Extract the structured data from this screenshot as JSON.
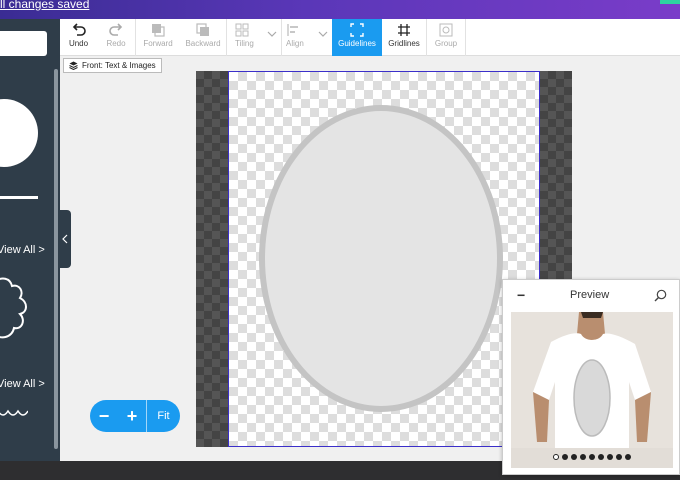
{
  "topbar": {
    "status_text": "ll changes saved"
  },
  "sidebar": {
    "view_all_1": "View All >",
    "view_all_2": "View All >"
  },
  "toolbar": {
    "items": [
      {
        "label": "Undo",
        "icon": "undo-icon",
        "enabled": true
      },
      {
        "label": "Redo",
        "icon": "redo-icon",
        "enabled": false
      },
      {
        "label": "Forward",
        "icon": "bring-forward-icon",
        "enabled": false
      },
      {
        "label": "Backward",
        "icon": "send-backward-icon",
        "enabled": false
      },
      {
        "label": "Tiling",
        "icon": "tiling-icon",
        "enabled": false
      },
      {
        "label": "Align",
        "icon": "align-icon",
        "enabled": false
      },
      {
        "label": "Guidelines",
        "icon": "guidelines-icon",
        "enabled": true,
        "active": true
      },
      {
        "label": "Gridlines",
        "icon": "gridlines-icon",
        "enabled": true
      },
      {
        "label": "Group",
        "icon": "group-icon",
        "enabled": false
      }
    ]
  },
  "layer_tag": {
    "label": "Front: Text & Images",
    "icon": "layers-icon"
  },
  "zoom": {
    "minus": "−",
    "plus": "+",
    "fit": "Fit"
  },
  "preview": {
    "title": "Preview",
    "collapse": "−",
    "dots_count": 9,
    "active_dot": 0
  },
  "colors": {
    "accent": "#1a9bf0",
    "sidebar": "#2f3d49",
    "topbar_start": "#3a2c93",
    "topbar_end": "#7a3cc9",
    "bounds_border": "#3b2fc9"
  }
}
